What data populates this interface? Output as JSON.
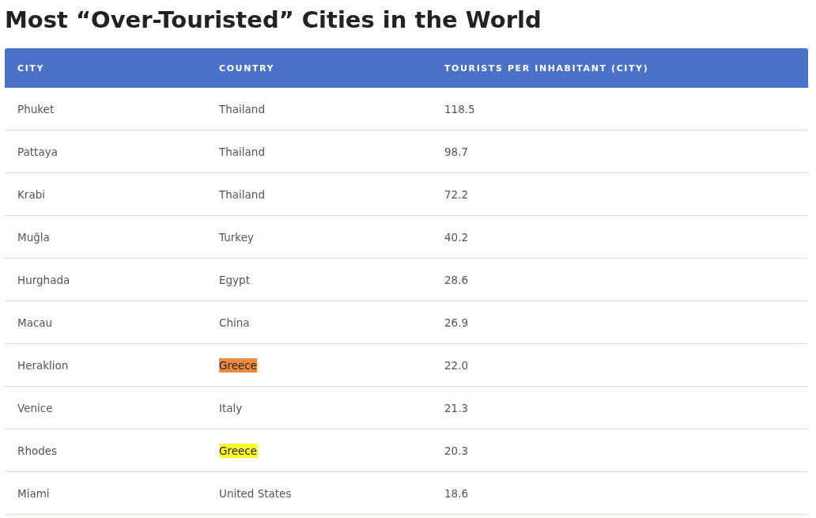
{
  "title": "Most “Over-Touristed” Cities in the World",
  "table": {
    "columns": [
      "CITY",
      "COUNTRY",
      "TOURISTS PER INHABITANT (CITY)"
    ],
    "rows": [
      {
        "city": "Phuket",
        "country": "Thailand",
        "value": "118.5"
      },
      {
        "city": "Pattaya",
        "country": "Thailand",
        "value": "98.7"
      },
      {
        "city": "Krabi",
        "country": "Thailand",
        "value": "72.2"
      },
      {
        "city": "Muğla",
        "country": "Turkey",
        "value": "40.2"
      },
      {
        "city": "Hurghada",
        "country": "Egypt",
        "value": "28.6"
      },
      {
        "city": "Macau",
        "country": "China",
        "value": "26.9"
      },
      {
        "city": "Heraklion",
        "country": "Greece",
        "value": "22.0",
        "color": "#f28c3c"
      },
      {
        "city": "Venice",
        "country": "Italy",
        "value": "21.3"
      },
      {
        "city": "Rhodes",
        "country": "Greece",
        "value": "20.3",
        "color": "#ffff26"
      },
      {
        "city": "Miami",
        "country": "United States",
        "value": "18.6"
      }
    ]
  }
}
